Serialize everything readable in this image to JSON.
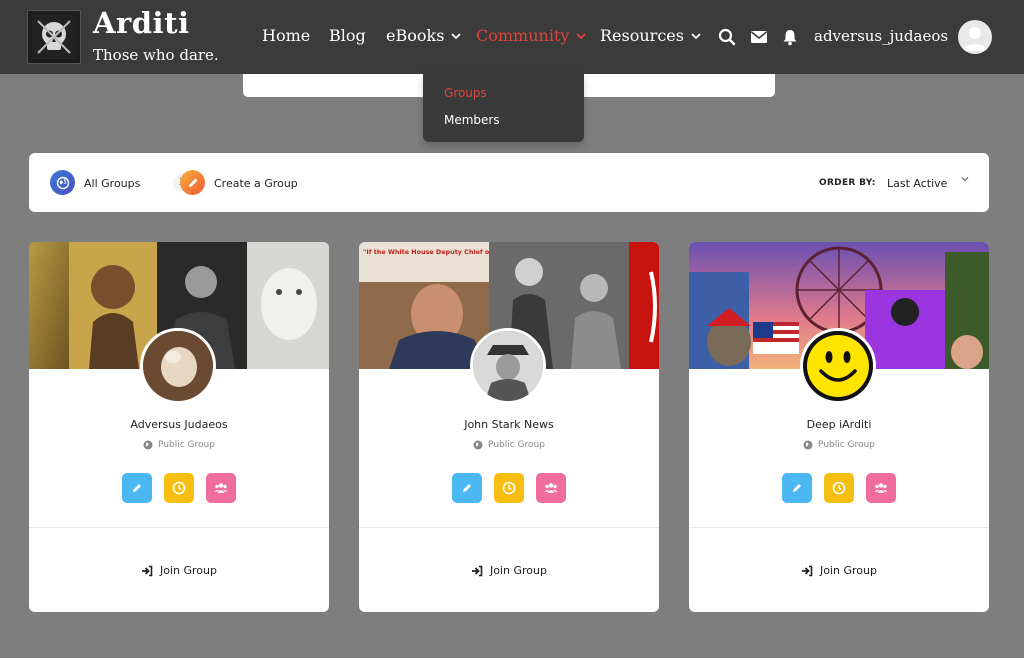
{
  "header": {
    "site_title": "Arditi",
    "tagline": "Those who dare.",
    "nav": {
      "home": "Home",
      "blog": "Blog",
      "ebooks": "eBooks",
      "community": "Community",
      "resources": "Resources"
    },
    "username": "adversus_judaeos",
    "active_color": "#e0433c"
  },
  "dropdown": {
    "groups": "Groups",
    "members": "Members"
  },
  "filter_bar": {
    "all_groups_label": "All Groups",
    "all_groups_count": "3",
    "create_group_label": "Create a Group",
    "order_by_label": "ORDER BY:",
    "order_by_value": "Last Active"
  },
  "groups": [
    {
      "name": "Adversus Judaeos",
      "type": "Public Group",
      "join_label": "Join Group"
    },
    {
      "name": "John Stark News",
      "type": "Public Group",
      "join_label": "Join Group"
    },
    {
      "name": "Deep iArditi",
      "type": "Public Group",
      "join_label": "Join Group"
    }
  ],
  "cover_captions": {
    "stark_news": "\"If the White House Deputy Chief of Staff calls you, you better be taking the phone call.\""
  },
  "colors": {
    "edit_button": "#4bb8f2",
    "clock_button": "#f6be0f",
    "members_button": "#f06b9e"
  }
}
